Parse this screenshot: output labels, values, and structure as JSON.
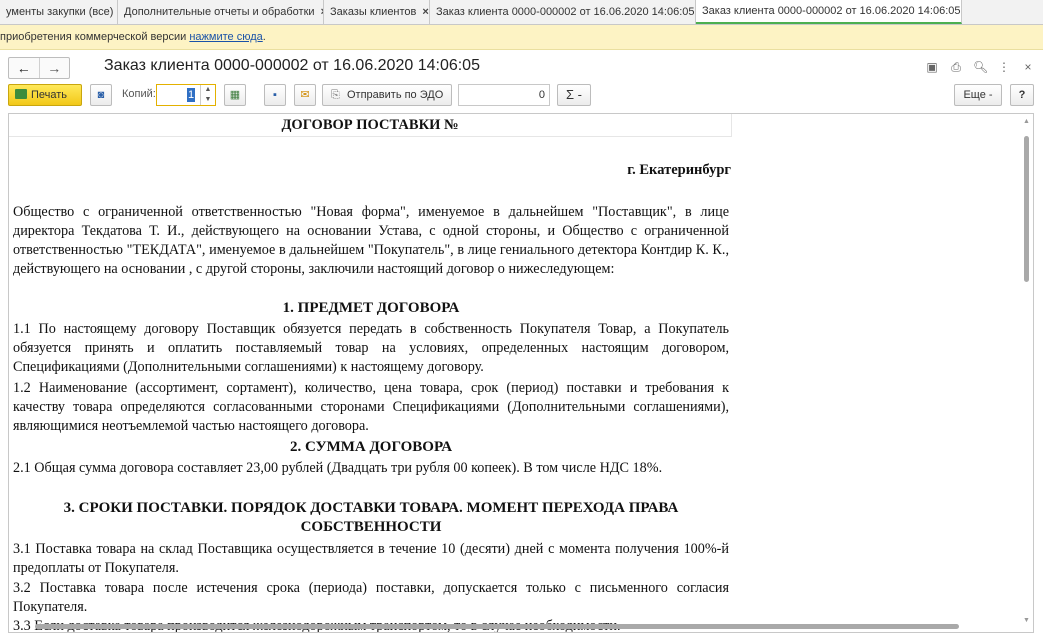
{
  "tabs": [
    {
      "label": "ументы закупки (все)",
      "active": false
    },
    {
      "label": "Дополнительные отчеты и обработки",
      "active": false
    },
    {
      "label": "Заказы клиентов",
      "active": false
    },
    {
      "label": "Заказ клиента 0000-000002 от 16.06.2020 14:06:05",
      "active": false
    },
    {
      "label": "Заказ клиента 0000-000002 от 16.06.2020 14:06:05",
      "active": true
    }
  ],
  "banner": {
    "text": "приобретения коммерческой версии ",
    "link": "нажмите сюда",
    "suffix": "."
  },
  "window": {
    "title": "Заказ клиента 0000-000002 от 16.06.2020 14:06:05",
    "back": "←",
    "forward": "→"
  },
  "toolbar": {
    "print_label": "Печать",
    "copies_label": "Копий:",
    "copies_value": "1",
    "send_edo_label": "Отправить по ЭДО",
    "sum_value": "0",
    "sigma_label": "Σ -",
    "more_label": "Еще -",
    "help_label": "?"
  },
  "document": {
    "heading": "ДОГОВОР ПОСТАВКИ №",
    "city": "г. Екатеринбург",
    "intro": "Общество с ограниченной ответственностью \"Новая форма\", именуемое в дальнейшем \"Поставщик\", в лице директора Текдатова Т. И., действующего на основании Устава, с одной стороны, и Общество с ограниченной ответственностью \"ТЕКДАТА\", именуемое в дальнейшем \"Покупатель\", в лице гениального детектора Контдир К. К., действующего на основании , с другой стороны, заключили настоящий договор о нижеследующем:",
    "section1_title": "1.  ПРЕДМЕТ ДОГОВОРА",
    "p1_1": "1.1 По настоящему договору Поставщик обязуется передать в собственность Покупателя Товар, а Покупатель обязуется принять и оплатить поставляемый товар на условиях, определенных настоящим договором, Спецификациями (Дополнительными соглашениями) к настоящему договору.",
    "p1_2": "1.2 Наименование (ассортимент, сортамент), количество, цена товара, срок (период) поставки и требования к качеству товара определяются  согласованными сторонами Спецификациями (Дополнительными соглашениями), являющимися неотъемлемой частью настоящего договора.",
    "section2_title": "2.  СУММА ДОГОВОРА",
    "p2_1": "2.1 Общая сумма договора составляет 23,00 рублей (Двадцать три рубля 00 копеек). В том числе НДС 18%.",
    "section3_title_line1": "3. СРОКИ ПОСТАВКИ. ПОРЯДОК ДОСТАВКИ ТОВАРА. МОМЕНТ ПЕРЕХОДА ПРАВА",
    "section3_title_line2": "СОБСТВЕННОСТИ",
    "p3_1": "3.1 Поставка товара на склад Поставщика осуществляется в течение 10 (десяти) дней с момента получения 100%-й предоплаты от Покупателя.",
    "p3_2": "3.2 Поставка товара после истечения срока (периода) поставки, допускается только с письменного согласия Покупателя.",
    "p3_3": "3.3 Если доставка товара производится железнодорожным транспортом, то в случае необходимости."
  }
}
